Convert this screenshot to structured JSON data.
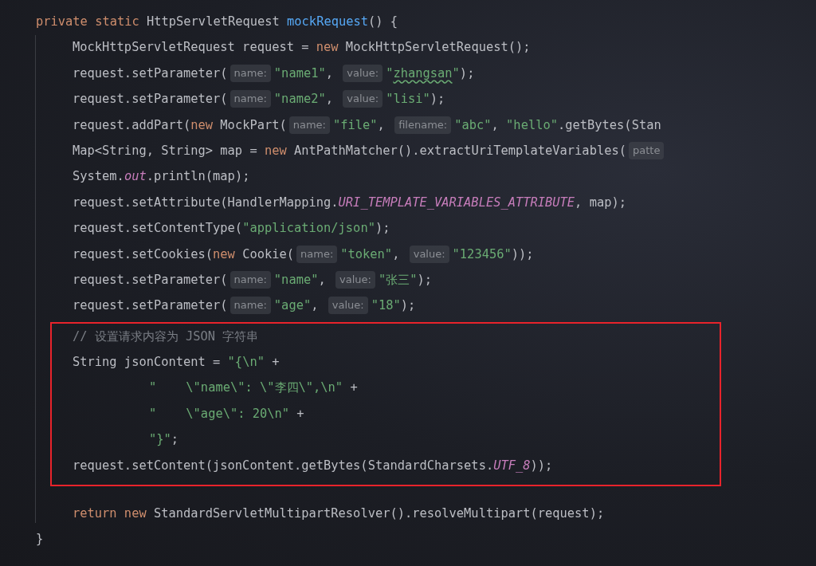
{
  "editor": {
    "blocks": [
      {
        "highlighted": false,
        "lines": [
          {
            "kind": "signature",
            "tokens": [
              {
                "kind": "keyword",
                "text": "private static "
              },
              {
                "kind": "plain",
                "text": "HttpServletRequest "
              },
              {
                "kind": "declaration",
                "text": "mockRequest"
              },
              {
                "kind": "plain",
                "text": "() {"
              }
            ]
          },
          {
            "kind": "body",
            "tokens": [
              {
                "kind": "plain",
                "text": "MockHttpServletRequest request = "
              },
              {
                "kind": "keyword",
                "text": "new"
              },
              {
                "kind": "plain",
                "text": " MockHttpServletRequest();"
              }
            ]
          },
          {
            "kind": "body",
            "tokens": [
              {
                "kind": "plain",
                "text": "request.setParameter("
              },
              {
                "kind": "hint",
                "text": "name:"
              },
              {
                "kind": "string",
                "text": "\"name1\""
              },
              {
                "kind": "plain",
                "text": ", "
              },
              {
                "kind": "hint",
                "text": "value:"
              },
              {
                "kind": "string",
                "text": "\""
              },
              {
                "kind": "typo",
                "text": "zhangsan"
              },
              {
                "kind": "string",
                "text": "\""
              },
              {
                "kind": "plain",
                "text": ");"
              }
            ]
          },
          {
            "kind": "body",
            "tokens": [
              {
                "kind": "plain",
                "text": "request.setParameter("
              },
              {
                "kind": "hint",
                "text": "name:"
              },
              {
                "kind": "string",
                "text": "\"name2\""
              },
              {
                "kind": "plain",
                "text": ", "
              },
              {
                "kind": "hint",
                "text": "value:"
              },
              {
                "kind": "string",
                "text": "\"lisi\""
              },
              {
                "kind": "plain",
                "text": ");"
              }
            ]
          },
          {
            "kind": "body",
            "tokens": [
              {
                "kind": "plain",
                "text": "request.addPart("
              },
              {
                "kind": "keyword",
                "text": "new"
              },
              {
                "kind": "plain",
                "text": " MockPart("
              },
              {
                "kind": "hint",
                "text": "name:"
              },
              {
                "kind": "string",
                "text": "\"file\""
              },
              {
                "kind": "plain",
                "text": ", "
              },
              {
                "kind": "hint",
                "text": "filename:"
              },
              {
                "kind": "string",
                "text": "\"abc\""
              },
              {
                "kind": "plain",
                "text": ", "
              },
              {
                "kind": "string",
                "text": "\"hello\""
              },
              {
                "kind": "plain",
                "text": ".getBytes(Stan"
              }
            ]
          },
          {
            "kind": "body",
            "tokens": [
              {
                "kind": "plain",
                "text": "Map<String, String> map = "
              },
              {
                "kind": "keyword",
                "text": "new"
              },
              {
                "kind": "plain",
                "text": " AntPathMatcher().extractUriTemplateVariables("
              },
              {
                "kind": "hint",
                "text": "patte"
              }
            ]
          },
          {
            "kind": "body",
            "tokens": [
              {
                "kind": "plain",
                "text": "System."
              },
              {
                "kind": "static",
                "text": "out"
              },
              {
                "kind": "plain",
                "text": ".println(map);"
              }
            ]
          },
          {
            "kind": "body",
            "tokens": [
              {
                "kind": "plain",
                "text": "request.setAttribute(HandlerMapping."
              },
              {
                "kind": "static",
                "text": "URI_TEMPLATE_VARIABLES_ATTRIBUTE"
              },
              {
                "kind": "plain",
                "text": ", map);"
              }
            ]
          },
          {
            "kind": "body",
            "tokens": [
              {
                "kind": "plain",
                "text": "request.setContentType("
              },
              {
                "kind": "string",
                "text": "\"application/json\""
              },
              {
                "kind": "plain",
                "text": ");"
              }
            ]
          },
          {
            "kind": "body",
            "tokens": [
              {
                "kind": "plain",
                "text": "request.setCookies("
              },
              {
                "kind": "keyword",
                "text": "new"
              },
              {
                "kind": "plain",
                "text": " Cookie("
              },
              {
                "kind": "hint",
                "text": "name:"
              },
              {
                "kind": "string",
                "text": "\"token\""
              },
              {
                "kind": "plain",
                "text": ", "
              },
              {
                "kind": "hint",
                "text": "value:"
              },
              {
                "kind": "string",
                "text": "\"123456\""
              },
              {
                "kind": "plain",
                "text": "));"
              }
            ]
          },
          {
            "kind": "body",
            "tokens": [
              {
                "kind": "plain",
                "text": "request.setParameter("
              },
              {
                "kind": "hint",
                "text": "name:"
              },
              {
                "kind": "string",
                "text": "\"name\""
              },
              {
                "kind": "plain",
                "text": ", "
              },
              {
                "kind": "hint",
                "text": "value:"
              },
              {
                "kind": "string",
                "text": "\"张三\""
              },
              {
                "kind": "plain",
                "text": ");"
              }
            ]
          },
          {
            "kind": "body",
            "tokens": [
              {
                "kind": "plain",
                "text": "request.setParameter("
              },
              {
                "kind": "hint",
                "text": "name:"
              },
              {
                "kind": "string",
                "text": "\"age\""
              },
              {
                "kind": "plain",
                "text": ", "
              },
              {
                "kind": "hint",
                "text": "value:"
              },
              {
                "kind": "string",
                "text": "\"18\""
              },
              {
                "kind": "plain",
                "text": ");"
              }
            ]
          }
        ]
      },
      {
        "highlighted": true,
        "lines": [
          {
            "kind": "body",
            "tokens": [
              {
                "kind": "comment",
                "text": "// 设置请求内容为 JSON 字符串"
              }
            ]
          },
          {
            "kind": "body",
            "tokens": [
              {
                "kind": "plain",
                "text": "String jsonContent = "
              },
              {
                "kind": "string",
                "text": "\"{\\n\""
              },
              {
                "kind": "plain",
                "text": " +"
              }
            ]
          },
          {
            "kind": "continuation",
            "tokens": [
              {
                "kind": "string",
                "text": "\"    \\\"name\\\": \\\"李四\\\",\\n\""
              },
              {
                "kind": "plain",
                "text": " +"
              }
            ]
          },
          {
            "kind": "continuation",
            "tokens": [
              {
                "kind": "string",
                "text": "\"    \\\"age\\\": 20\\n\""
              },
              {
                "kind": "plain",
                "text": " +"
              }
            ]
          },
          {
            "kind": "continuation",
            "tokens": [
              {
                "kind": "string",
                "text": "\"}\""
              },
              {
                "kind": "plain",
                "text": ";"
              }
            ]
          },
          {
            "kind": "body",
            "tokens": [
              {
                "kind": "plain",
                "text": "request.setContent(jsonContent.getBytes(StandardCharsets."
              },
              {
                "kind": "static",
                "text": "UTF_8"
              },
              {
                "kind": "plain",
                "text": "));"
              }
            ]
          }
        ]
      },
      {
        "highlighted": false,
        "lines": [
          {
            "kind": "blank"
          },
          {
            "kind": "body",
            "tokens": [
              {
                "kind": "keyword",
                "text": "return new "
              },
              {
                "kind": "plain",
                "text": "StandardServletMultipartResolver().resolveMultipart(request);"
              }
            ]
          },
          {
            "kind": "close",
            "tokens": [
              {
                "kind": "plain",
                "text": "}"
              }
            ]
          }
        ]
      }
    ]
  }
}
